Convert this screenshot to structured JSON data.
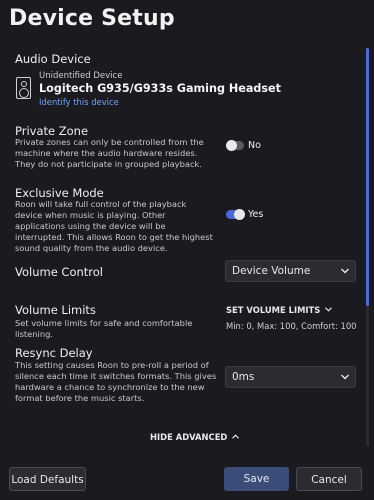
{
  "window": {
    "title": "Device Setup"
  },
  "audio_device": {
    "section_label": "Audio Device",
    "status": "Unidentified Device",
    "name": "Logitech G935/G933s Gaming Headset",
    "identify_link": "Identify this device"
  },
  "private_zone": {
    "title": "Private Zone",
    "description": "Private zones can only be controlled from the machine where the audio hardware resides. They do not participate in grouped playback.",
    "toggle_label": "No",
    "enabled": false
  },
  "exclusive_mode": {
    "title": "Exclusive Mode",
    "description": "Roon will take full control of the playback device when music is playing. Other applications using the device will be interrupted. This allows Roon to get the highest sound quality from the audio device.",
    "toggle_label": "Yes",
    "enabled": true
  },
  "volume_control": {
    "title": "Volume Control",
    "selected": "Device Volume"
  },
  "volume_limits": {
    "title": "Volume Limits",
    "description": "Set volume limits for safe and comfortable listening.",
    "action_label": "SET VOLUME LIMITS",
    "summary": "Min: 0, Max: 100, Comfort: 100"
  },
  "resync_delay": {
    "title": "Resync Delay",
    "description": "This setting causes Roon to pre-roll a period of silence each time it switches formats. This gives hardware a chance to synchronize to the new format before the music starts.",
    "selected": "0ms"
  },
  "advanced_toggle": {
    "label": "HIDE ADVANCED"
  },
  "footer": {
    "load_defaults": "Load Defaults",
    "save": "Save",
    "cancel": "Cancel"
  },
  "colors": {
    "background": "#1b1b1f",
    "accent": "#4a6bd8",
    "link": "#6fa3ff",
    "save_button": "#3b4c79"
  }
}
